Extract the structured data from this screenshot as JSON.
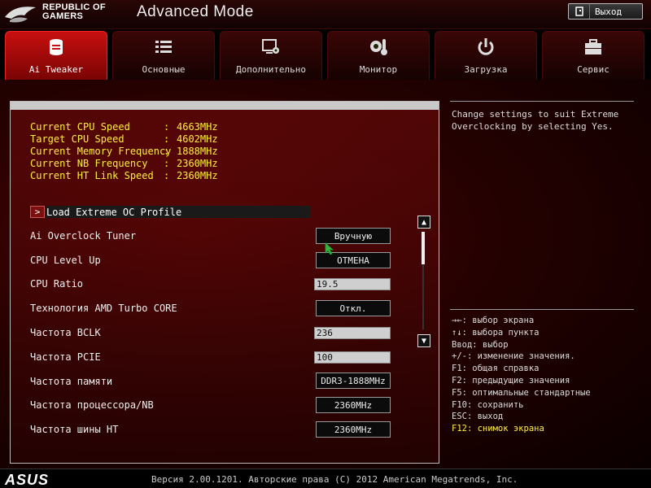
{
  "header": {
    "brand_line1": "REPUBLIC OF",
    "brand_line2": "GAMERS",
    "title": "Advanced Mode",
    "exit_label": "Выход"
  },
  "tabs": [
    {
      "label": "Ai Tweaker",
      "icon": "cylinder-icon",
      "active": true
    },
    {
      "label": "Основные",
      "icon": "list-icon",
      "active": false
    },
    {
      "label": "Дополнительно",
      "icon": "advanced-settings-icon",
      "active": false
    },
    {
      "label": "Монитор",
      "icon": "gear-thermometer-icon",
      "active": false
    },
    {
      "label": "Загрузка",
      "icon": "power-icon",
      "active": false
    },
    {
      "label": "Сервис",
      "icon": "toolbox-icon",
      "active": false
    }
  ],
  "frequencies": [
    {
      "label": "Current CPU Speed",
      "value": "4663MHz"
    },
    {
      "label": "Target CPU Speed",
      "value": "4602MHz"
    },
    {
      "label": "Current Memory Frequency",
      "value": "1888MHz"
    },
    {
      "label": "Current NB Frequency",
      "value": "2360MHz"
    },
    {
      "label": "Current HT Link Speed",
      "value": "2360MHz"
    }
  ],
  "freq_separator": ":",
  "load_oc": {
    "arrow": ">",
    "label": "Load Extreme OC Profile"
  },
  "settings": [
    {
      "label": "Ai Overclock Tuner",
      "value": "Вручную",
      "kind": "dropdown"
    },
    {
      "label": "CPU Level Up",
      "value": "ОТМЕНА",
      "kind": "dropdown"
    },
    {
      "label": "CPU Ratio",
      "value": "19.5",
      "kind": "text"
    },
    {
      "label": "Технология AMD Turbo CORE",
      "value": "Откл.",
      "kind": "dropdown"
    },
    {
      "label": "Частота BCLK",
      "value": "236",
      "kind": "text"
    },
    {
      "label": "Частота PCIE",
      "value": "100",
      "kind": "text"
    },
    {
      "label": "Частота памяти",
      "value": "DDR3-1888MHz",
      "kind": "dropdown"
    },
    {
      "label": "Частота процессора/NB",
      "value": "2360MHz",
      "kind": "dropdown"
    },
    {
      "label": "Частота шины HT",
      "value": "2360MHz",
      "kind": "dropdown"
    }
  ],
  "help": {
    "line1": "Change settings to suit Extreme",
    "line2": "Overclocking by selecting Yes."
  },
  "keys": [
    "→←: выбор экрана",
    "↑↓: выбора пункта",
    "Ввод: выбор",
    "+/-: изменение значения.",
    "F1: общая справка",
    "F2: предыдущие значения",
    "F5: оптимальные стандартные",
    "F10: сохранить",
    "ESC: выход",
    "F12: снимок экрана"
  ],
  "footer": {
    "asus": "ASUS",
    "version": "Версия 2.00.1201. Авторские права (C) 2012 American Megatrends, Inc."
  },
  "colors": {
    "accent_red": "#c80f0f",
    "freq_yellow": "#ffef3a",
    "background": "#260101"
  }
}
